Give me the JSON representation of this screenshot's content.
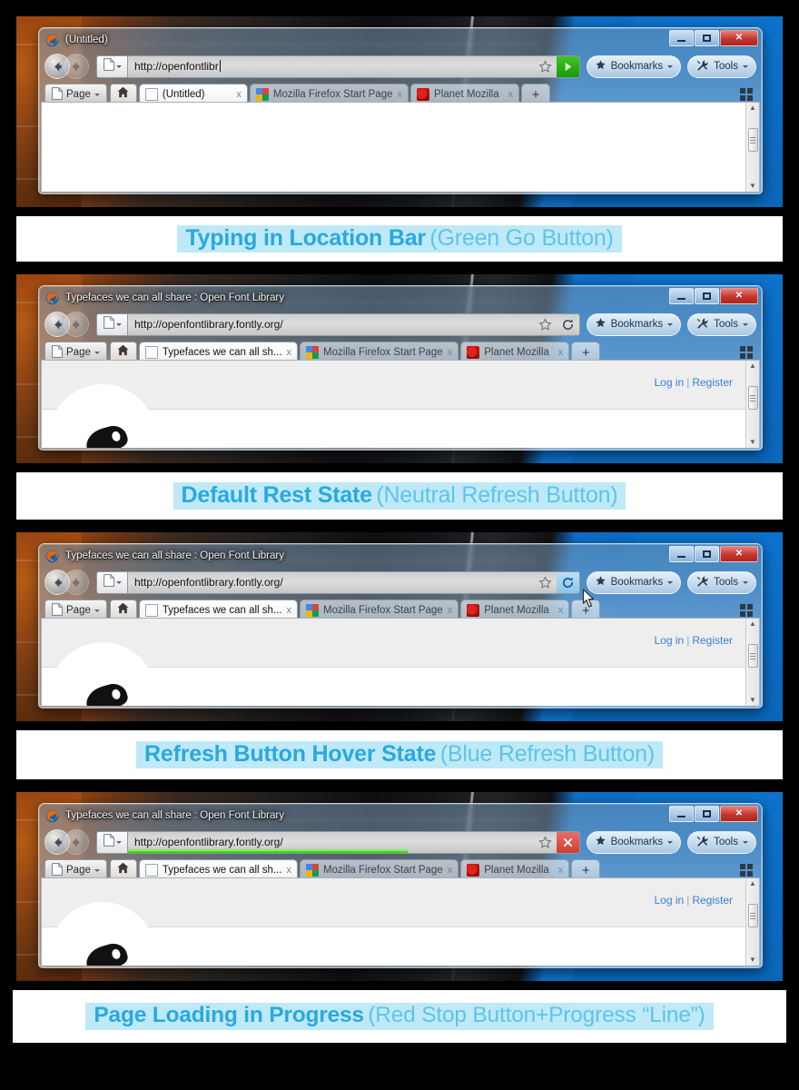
{
  "window_controls": {
    "minimize": "minimize",
    "maximize": "maximize",
    "close": "close"
  },
  "toolbar": {
    "bookmarks_label": "Bookmarks",
    "tools_label": "Tools",
    "page_label": "Page",
    "home_label": "home-icon",
    "new_tab_label": "+",
    "back_label": "back-icon",
    "forward_label": "forward-icon",
    "star_label": "bookmark-star-icon",
    "grid_label": "tab-groups-icon"
  },
  "page_content": {
    "login": "Log in",
    "separator": "|",
    "register": "Register"
  },
  "colors": {
    "go_green": "#21a80c",
    "stop_red": "#cf3a32",
    "hover_blue": "#8cc3e8",
    "progress_green": "#3cdf00",
    "caption_text": "#2aa8e0",
    "caption_highlight": "#bfe9f7"
  },
  "panels": [
    {
      "id": "typing",
      "window_title": "(Untitled)",
      "url_value": "http://openfontlibr",
      "url_has_caret": true,
      "action_button": "go",
      "action_icon": "green-go-arrow-icon",
      "progress_percent": 0,
      "show_cursor": false,
      "show_page_content": false,
      "tabs": [
        {
          "title": "(Untitled)",
          "favicon": "blank",
          "active": true,
          "close": "x"
        },
        {
          "title": "Mozilla Firefox Start Page",
          "favicon": "goog",
          "active": false,
          "close": "x"
        },
        {
          "title": "Planet Mozilla",
          "favicon": "moz",
          "active": false,
          "close": "x"
        }
      ],
      "caption_bold": "Typing in Location Bar",
      "caption_light": "(Green Go Button)"
    },
    {
      "id": "rest",
      "window_title": "Typefaces we can all share : Open Font Library",
      "url_value": "http://openfontlibrary.fontly.org/",
      "url_has_caret": false,
      "action_button": "neutral",
      "action_icon": "refresh-icon",
      "progress_percent": 0,
      "show_cursor": false,
      "show_page_content": true,
      "tabs": [
        {
          "title": "Typefaces we can all sh...",
          "favicon": "blank",
          "active": true,
          "close": "x"
        },
        {
          "title": "Mozilla Firefox Start Page",
          "favicon": "goog",
          "active": false,
          "close": "x"
        },
        {
          "title": "Planet Mozilla",
          "favicon": "moz",
          "active": false,
          "close": "x"
        }
      ],
      "caption_bold": "Default Rest State",
      "caption_light": "(Neutral Refresh Button)"
    },
    {
      "id": "hover",
      "window_title": "Typefaces we can all share : Open Font Library",
      "url_value": "http://openfontlibrary.fontly.org/",
      "url_has_caret": false,
      "action_button": "hover",
      "action_icon": "refresh-icon",
      "progress_percent": 0,
      "show_cursor": true,
      "show_page_content": true,
      "tabs": [
        {
          "title": "Typefaces we can all sh...",
          "favicon": "blank",
          "active": true,
          "close": "x"
        },
        {
          "title": "Mozilla Firefox Start Page",
          "favicon": "goog",
          "active": false,
          "close": "x"
        },
        {
          "title": "Planet Mozilla",
          "favicon": "moz",
          "active": false,
          "close": "x"
        }
      ],
      "caption_bold": "Refresh Button Hover State",
      "caption_light": "(Blue Refresh Button)"
    },
    {
      "id": "loading",
      "window_title": "Typefaces we can all share : Open Font Library",
      "url_value": "http://openfontlibrary.fontly.org/",
      "url_has_caret": false,
      "action_button": "stop",
      "action_icon": "red-stop-x-icon",
      "progress_percent": 62,
      "show_cursor": false,
      "show_page_content": true,
      "tabs": [
        {
          "title": "Typefaces we can all sh...",
          "favicon": "blank",
          "active": true,
          "close": "x"
        },
        {
          "title": "Mozilla Firefox Start Page",
          "favicon": "goog",
          "active": false,
          "close": "x"
        },
        {
          "title": "Planet Mozilla",
          "favicon": "moz",
          "active": false,
          "close": "x"
        }
      ],
      "caption_bold": "Page Loading in Progress",
      "caption_light": "(Red Stop Button+Progress “Line”)"
    }
  ]
}
